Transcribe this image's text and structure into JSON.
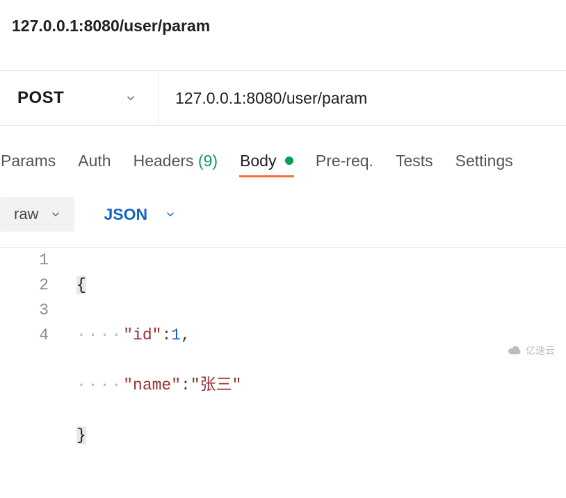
{
  "title": "127.0.0.1:8080/user/param",
  "request": {
    "method": "POST",
    "url": "127.0.0.1:8080/user/param"
  },
  "tabs": {
    "params": "Params",
    "auth": "Auth",
    "headers_label": "Headers",
    "headers_count": "(9)",
    "body": "Body",
    "pre": "Pre-req.",
    "tests": "Tests",
    "settings": "Settings",
    "active": "body",
    "body_changed": true
  },
  "body_type": {
    "mode": "raw",
    "language": "JSON"
  },
  "editor": {
    "lines": [
      "1",
      "2",
      "3",
      "4"
    ],
    "content": {
      "l1_brace_open": "{",
      "l2_key": "\"id\"",
      "l2_colon": ":",
      "l2_val": "1",
      "l2_comma": ",",
      "l3_key": "\"name\"",
      "l3_colon": ":",
      "l3_val": "\"张三\"",
      "l4_brace_close": "}"
    },
    "json_payload": {
      "id": 1,
      "name": "张三"
    }
  },
  "watermark": "亿速云"
}
